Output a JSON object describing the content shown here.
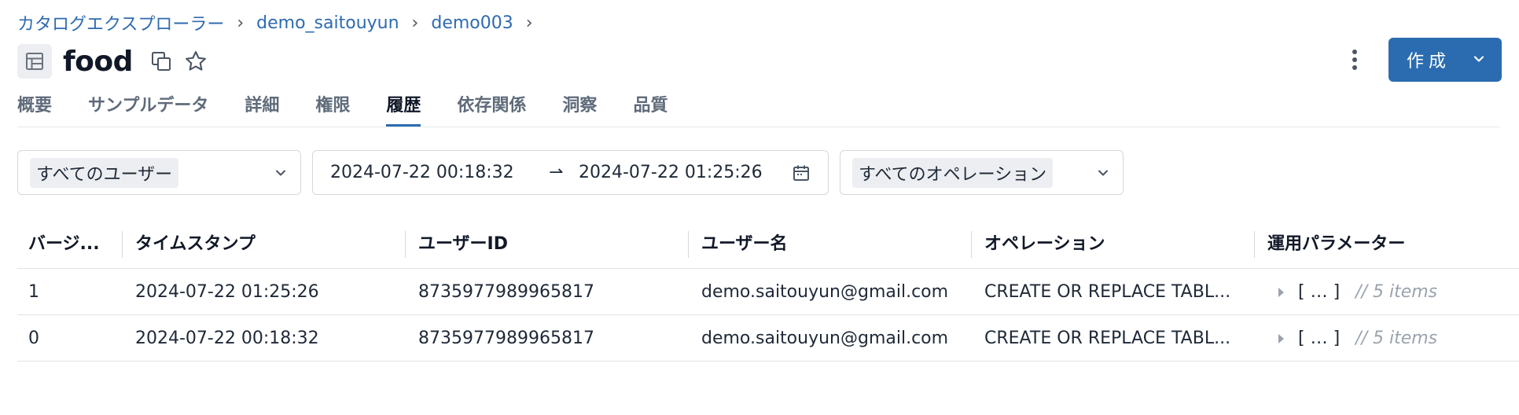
{
  "breadcrumb": {
    "items": [
      "カタログエクスプローラー",
      "demo_saitouyun",
      "demo003"
    ],
    "separator": "›"
  },
  "header": {
    "title": "food",
    "create_label": "作成",
    "icons": {
      "table": "table-icon",
      "copy": "copy-icon",
      "favorite": "star-icon",
      "more": "kebab-menu-icon",
      "dropdown": "chevron-down-icon"
    }
  },
  "tabs": [
    {
      "label": "概要",
      "active": false
    },
    {
      "label": "サンプルデータ",
      "active": false
    },
    {
      "label": "詳細",
      "active": false
    },
    {
      "label": "権限",
      "active": false
    },
    {
      "label": "履歴",
      "active": true
    },
    {
      "label": "依存関係",
      "active": false
    },
    {
      "label": "洞察",
      "active": false
    },
    {
      "label": "品質",
      "active": false
    }
  ],
  "filters": {
    "user": "すべてのユーザー",
    "date_from": "2024-07-22 00:18:32",
    "date_arrow": "⇀",
    "date_to": "2024-07-22 01:25:26",
    "operation": "すべてのオペレーション"
  },
  "table": {
    "columns": [
      "バージ...",
      "タイムスタンプ",
      "ユーザーID",
      "ユーザー名",
      "オペレーション",
      "運用パラメーター"
    ],
    "rows": [
      {
        "version": "1",
        "timestamp": "2024-07-22 01:25:26",
        "user_id": "8735977989965817",
        "user_name": "demo.saitouyun@gmail.com",
        "operation": "CREATE OR REPLACE TABL...",
        "params_bracket": "[ … ]",
        "params_count": "// 5 items"
      },
      {
        "version": "0",
        "timestamp": "2024-07-22 00:18:32",
        "user_id": "8735977989965817",
        "user_name": "demo.saitouyun@gmail.com",
        "operation": "CREATE OR REPLACE TABL...",
        "params_bracket": "[ … ]",
        "params_count": "// 5 items"
      }
    ]
  },
  "colors": {
    "accent": "#2b6cb0",
    "link": "#2e6bb0",
    "muted": "#9aa3ad"
  }
}
